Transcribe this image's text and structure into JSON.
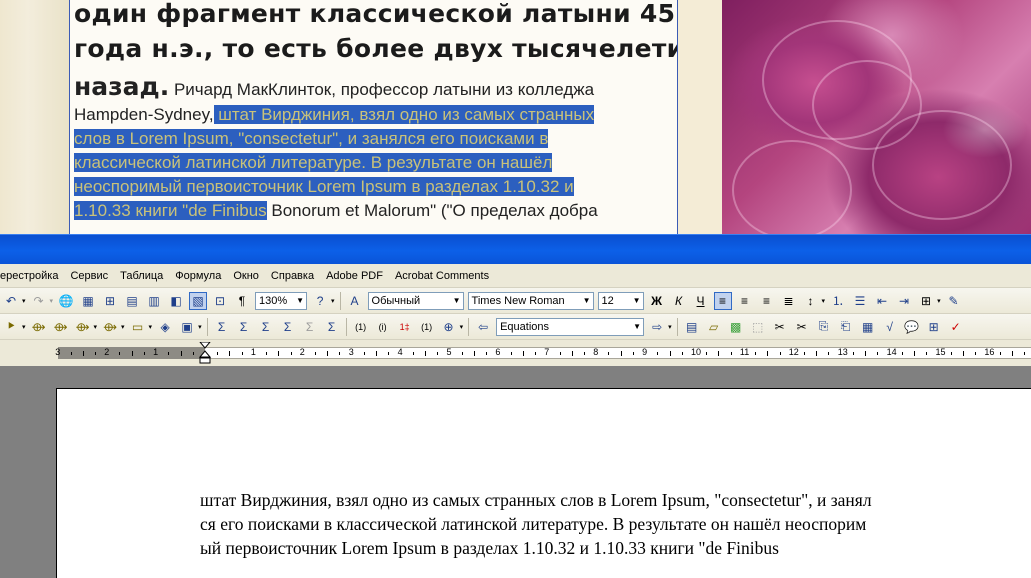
{
  "image_text": {
    "bold_lines": [
      "один фрагмент классической латыни 45",
      "года н.э., то есть более двух тысячелетий"
    ],
    "bold_lead": "назад.",
    "body_line1_rest": " Ричард МакКлинток, профессор латыни из колледжа",
    "line2_plain": "Hampden-Sydney,",
    "line2_selected": " штат Вирджиния, взял одно из самых странных",
    "line3_selected": "слов в Lorem Ipsum, \"consectetur\", и занялся его поисками в",
    "line4_selected": "классической латинской литературе. В результате он нашёл",
    "line5_selected": "неоспоримый первоисточник Lorem Ipsum в разделах 1.10.32 и",
    "line6_selected": "1.10.33 книги \"de Finibus",
    "line6_plain": " Bonorum et Malorum\" (\"О пределах добра"
  },
  "menubar": {
    "items": [
      "ерестройка",
      "Сервис",
      "Таблица",
      "Формула",
      "Окно",
      "Справка",
      "Adobe PDF",
      "Acrobat Comments"
    ]
  },
  "toolbar": {
    "zoom": "130%",
    "style": "Обычный",
    "font": "Times New Roman",
    "size": "12",
    "equation_style": "Equations"
  },
  "ruler": {
    "labels": [
      "3",
      "2",
      "1",
      "1",
      "2",
      "3",
      "4",
      "5",
      "6",
      "7",
      "8",
      "9",
      "10",
      "11",
      "12",
      "13",
      "14",
      "15",
      "16"
    ]
  },
  "document": {
    "lines": [
      " штат Вирджиния, взял одно из самых странных слов в Lorem Ipsum, \"consectetur\", и занял",
      "ся его поисками в классической латинской литературе. В результате он нашёл неоспорим",
      "ый первоисточник Lorem Ipsum в разделах 1.10.32 и 1.10.33 книги \"de Finibus"
    ]
  },
  "colors": {
    "selection": "#2c5fbf",
    "title_bar": "#0c60e8",
    "toolbar_bg": "#ece9d8"
  }
}
